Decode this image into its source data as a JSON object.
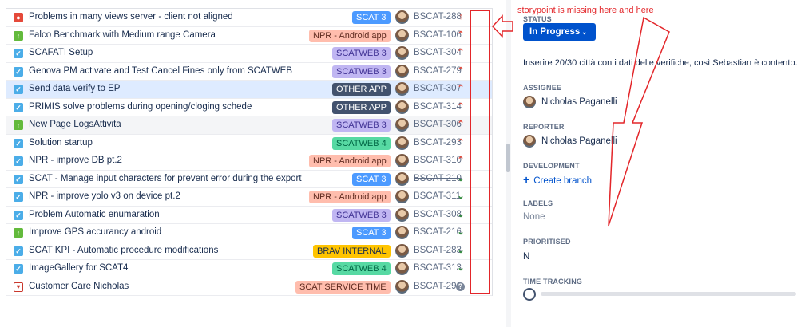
{
  "issues": [
    {
      "type": "bug",
      "type_icon": "bug-icon",
      "summary": "Problems in many views server - client not aligned",
      "epic": "SCAT 3",
      "epic_style": "blue",
      "key": "BSCAT-288",
      "done": false,
      "priority": "highest"
    },
    {
      "type": "story",
      "type_icon": "story-icon",
      "summary": "Falco Benchmark with Medium range Camera",
      "epic": "NPR - Android app",
      "epic_style": "salmon",
      "key": "BSCAT-106",
      "done": false,
      "priority": "high"
    },
    {
      "type": "task",
      "type_icon": "task-icon",
      "summary": "SCAFATI Setup",
      "epic": "SCATWEB 3",
      "epic_style": "lavender",
      "key": "BSCAT-304",
      "done": false,
      "priority": "high"
    },
    {
      "type": "task",
      "type_icon": "task-icon",
      "summary": "Genova PM activate and Test Cancel Fines only from SCATWEB",
      "epic": "SCATWEB 3",
      "epic_style": "lavender",
      "key": "BSCAT-279",
      "done": false,
      "priority": "high"
    },
    {
      "type": "task",
      "type_icon": "task-icon",
      "summary": "Send data verify to EP",
      "epic": "OTHER APP",
      "epic_style": "dark",
      "key": "BSCAT-307",
      "done": false,
      "priority": "high"
    },
    {
      "type": "task",
      "type_icon": "task-icon",
      "summary": "PRIMIS solve problems during opening/cloging schede",
      "epic": "OTHER APP",
      "epic_style": "dark",
      "key": "BSCAT-314",
      "done": false,
      "priority": "high"
    },
    {
      "type": "story",
      "type_icon": "story-icon",
      "summary": "New Page LogsAttivita",
      "epic": "SCATWEB 3",
      "epic_style": "lavender",
      "key": "BSCAT-306",
      "done": false,
      "priority": "high"
    },
    {
      "type": "task",
      "type_icon": "task-icon",
      "summary": "Solution startup",
      "epic": "SCATWEB 4",
      "epic_style": "green",
      "key": "BSCAT-293",
      "done": false,
      "priority": "high"
    },
    {
      "type": "task",
      "type_icon": "task-icon",
      "summary": "NPR - improve DB pt.2",
      "epic": "NPR - Android app",
      "epic_style": "salmon",
      "key": "BSCAT-310",
      "done": false,
      "priority": "high"
    },
    {
      "type": "task",
      "type_icon": "task-icon",
      "summary": "SCAT - Manage input characters for prevent error during the export",
      "epic": "SCAT 3",
      "epic_style": "blue",
      "key": "BSCAT-210",
      "done": true,
      "priority": "low"
    },
    {
      "type": "task",
      "type_icon": "task-icon",
      "summary": "NPR - improve yolo v3 on device pt.2",
      "epic": "NPR - Android app",
      "epic_style": "salmon",
      "key": "BSCAT-311",
      "done": false,
      "priority": "low"
    },
    {
      "type": "task",
      "type_icon": "task-icon",
      "summary": "Problem Automatic enumaration",
      "epic": "SCATWEB 3",
      "epic_style": "lavender",
      "key": "BSCAT-308",
      "done": false,
      "priority": "low"
    },
    {
      "type": "story",
      "type_icon": "story-icon",
      "summary": "Improve GPS accurancy android",
      "epic": "SCAT 3",
      "epic_style": "blue",
      "key": "BSCAT-216",
      "done": false,
      "priority": "low"
    },
    {
      "type": "task",
      "type_icon": "task-icon",
      "summary": "SCAT KPI - Automatic procedure modifications",
      "epic": "BRAV INTERNAL",
      "epic_style": "yellow",
      "key": "BSCAT-283",
      "done": false,
      "priority": "low"
    },
    {
      "type": "task",
      "type_icon": "task-icon",
      "summary": "ImageGallery for SCAT4",
      "epic": "SCATWEB 4",
      "epic_style": "green",
      "key": "BSCAT-313",
      "done": false,
      "priority": "low"
    },
    {
      "type": "care",
      "type_icon": "heart-icon",
      "summary": "Customer Care Nicholas",
      "epic": "SCAT SERVICE TIME",
      "epic_style": "salmon",
      "key": "BSCAT-296",
      "done": false,
      "priority": "none"
    }
  ],
  "epic_colors": {
    "blue": {
      "bg": "#4c9aff",
      "fg": "#ffffff"
    },
    "salmon": {
      "bg": "#ffbdad",
      "fg": "#5e2a1f"
    },
    "lavender": {
      "bg": "#c0b6f2",
      "fg": "#403294"
    },
    "dark": {
      "bg": "#42526e",
      "fg": "#ffffff"
    },
    "green": {
      "bg": "#57d9a3",
      "fg": "#064"
    },
    "yellow": {
      "bg": "#ffc400",
      "fg": "#172b4d"
    }
  },
  "detail": {
    "status_label": "STATUS",
    "status_value": "In Progress",
    "status_chevron": "⌄",
    "description": "Inserire 20/30 città con i dati delle verifiche, così Sebastian è contento.",
    "assignee_label": "ASSIGNEE",
    "assignee_name": "Nicholas Paganelli",
    "reporter_label": "REPORTER",
    "reporter_name": "Nicholas Paganelli",
    "development_label": "DEVELOPMENT",
    "create_branch": "Create branch",
    "labels_label": "LABELS",
    "labels_value": "None",
    "prioritised_label": "PRIORITISED",
    "prioritised_value": "N",
    "time_tracking_label": "TIME TRACKING"
  },
  "annotation": {
    "note": "storypoint is missing  here  and here",
    "color": "#e3262a"
  }
}
